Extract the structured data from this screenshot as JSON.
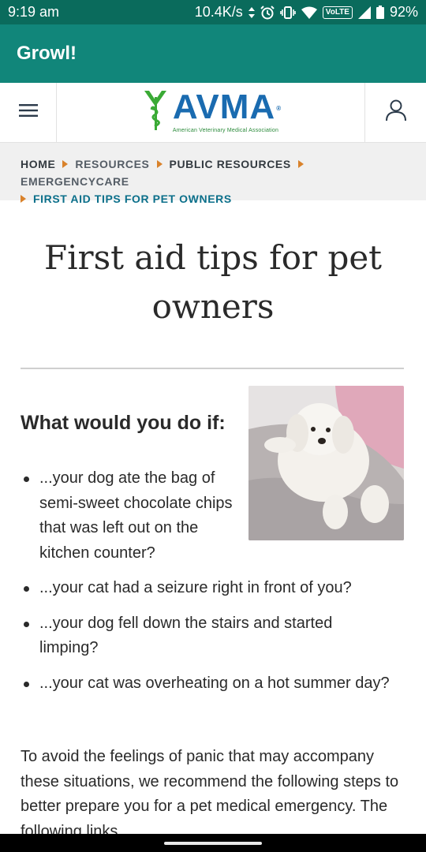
{
  "status_bar": {
    "time": "9:19 am",
    "network_speed": "10.4K/s",
    "volte": "VoLTE",
    "battery": "92%",
    "icons": [
      "data-arrows-icon",
      "alarm-icon",
      "vibrate-icon",
      "wifi-icon",
      "signal-icon",
      "battery-icon"
    ]
  },
  "app_bar": {
    "title": "Growl!"
  },
  "site_header": {
    "menu_icon": "hamburger-menu-icon",
    "logo": {
      "word": "AVMA",
      "reg": "®",
      "subtitle": "American Veterinary Medical Association"
    },
    "account_icon": "user-account-icon"
  },
  "breadcrumb": {
    "items": [
      "HOME",
      "RESOURCES",
      "PUBLIC RESOURCES",
      "EMERGENCYCARE",
      "FIRST AID TIPS FOR PET OWNERS"
    ]
  },
  "article": {
    "title": "First aid tips for pet owners",
    "subheading": "What would you do if:",
    "image": "dog-photo",
    "bullets": [
      "...your dog ate the bag of semi-sweet chocolate chips that was left out on the kitchen counter?",
      "...your cat had a seizure right in front of you?",
      "...your dog fell down the stairs and started limping?",
      "...your cat was overheating on a hot summer day?"
    ],
    "intro": "To avoid the feelings of panic that may accompany these situations, we recommend the following steps to better prepare you for a pet medical emergency. The following links"
  },
  "colors": {
    "status_bar": "#0a6b5c",
    "app_bar": "#11867a",
    "logo_blue": "#1a6bb0",
    "logo_green": "#3aaa35",
    "breadcrumb_arrow": "#d9822b",
    "breadcrumb_current": "#0b6f8a"
  }
}
